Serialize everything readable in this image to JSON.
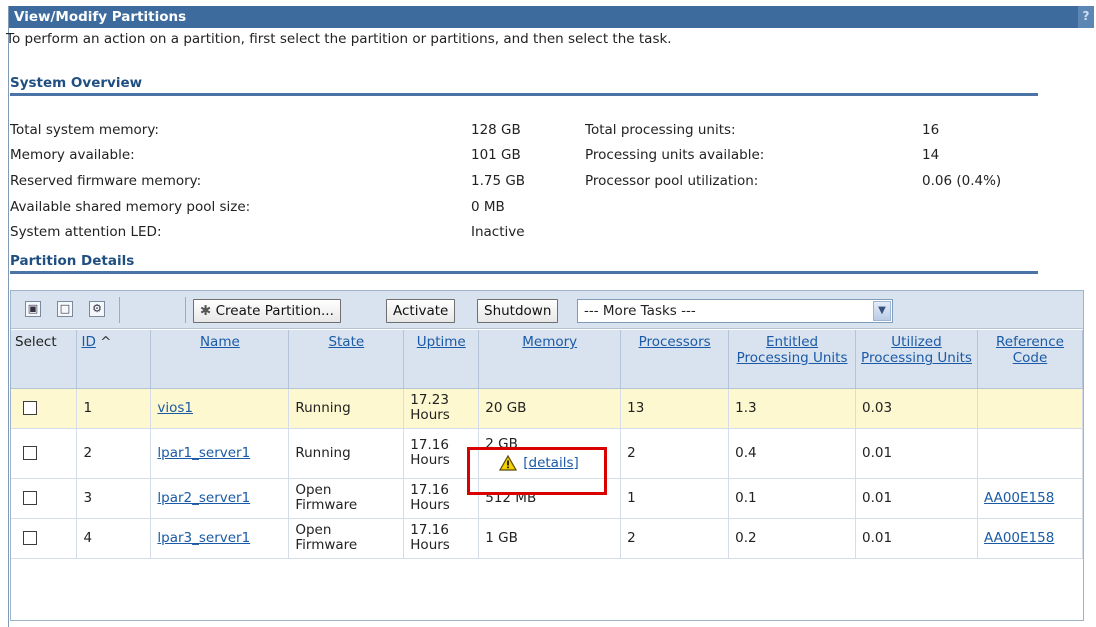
{
  "title": "View/Modify Partitions",
  "help": "?",
  "intro": "To perform an action on a partition, first select the partition or partitions, and then select the task.",
  "overview": {
    "heading": "System Overview",
    "left": [
      {
        "label": "Total system memory:",
        "value": "128 GB"
      },
      {
        "label": "Memory available:",
        "value": "101 GB"
      },
      {
        "label": "Reserved firmware memory:",
        "value": "1.75 GB"
      },
      {
        "label": "Available shared memory pool size:",
        "value": "0 MB"
      },
      {
        "label": "System attention LED:",
        "value": "Inactive"
      }
    ],
    "right": [
      {
        "label": "Total processing units:",
        "value": "16"
      },
      {
        "label": "Processing units available:",
        "value": "14"
      },
      {
        "label": "Processor pool utilization:",
        "value": "0.06 (0.4%)"
      }
    ]
  },
  "details": {
    "heading": "Partition Details",
    "toolbar": {
      "create": "Create Partition...",
      "activate": "Activate",
      "shutdown": "Shutdown",
      "more_tasks": "--- More Tasks ---"
    },
    "columns": {
      "select": "Select",
      "id": "ID",
      "name": "Name",
      "state": "State",
      "uptime": "Uptime",
      "memory": "Memory",
      "processors": "Processors",
      "entitled": "Entitled Processing Units",
      "utilized": "Utilized Processing Units",
      "refcode": "Reference Code"
    },
    "rows": [
      {
        "id": "1",
        "name": "vios1",
        "state": "Running",
        "uptime": "17.23 Hours",
        "memory": "20 GB",
        "processors": "13",
        "entitled": "1.3",
        "utilized": "0.03",
        "refcode": ""
      },
      {
        "id": "2",
        "name": "lpar1_server1",
        "state": "Running",
        "uptime": "17.16 Hours",
        "memory": "2 GB",
        "memory_link": "[details]",
        "processors": "2",
        "entitled": "0.4",
        "utilized": "0.01",
        "refcode": ""
      },
      {
        "id": "3",
        "name": "lpar2_server1",
        "state": "Open Firmware",
        "uptime": "17.16 Hours",
        "memory": "512 MB",
        "processors": "1",
        "entitled": "0.1",
        "utilized": "0.01",
        "refcode": "AA00E158"
      },
      {
        "id": "4",
        "name": "lpar3_server1",
        "state": "Open Firmware",
        "uptime": "17.16 Hours",
        "memory": "1 GB",
        "processors": "2",
        "entitled": "0.2",
        "utilized": "0.01",
        "refcode": "AA00E158"
      }
    ]
  },
  "colors": {
    "title_bar": "#3d6b9e",
    "selected_row": "#fdf8cf",
    "highlight": "#d90000",
    "link": "#1a5aa6"
  }
}
